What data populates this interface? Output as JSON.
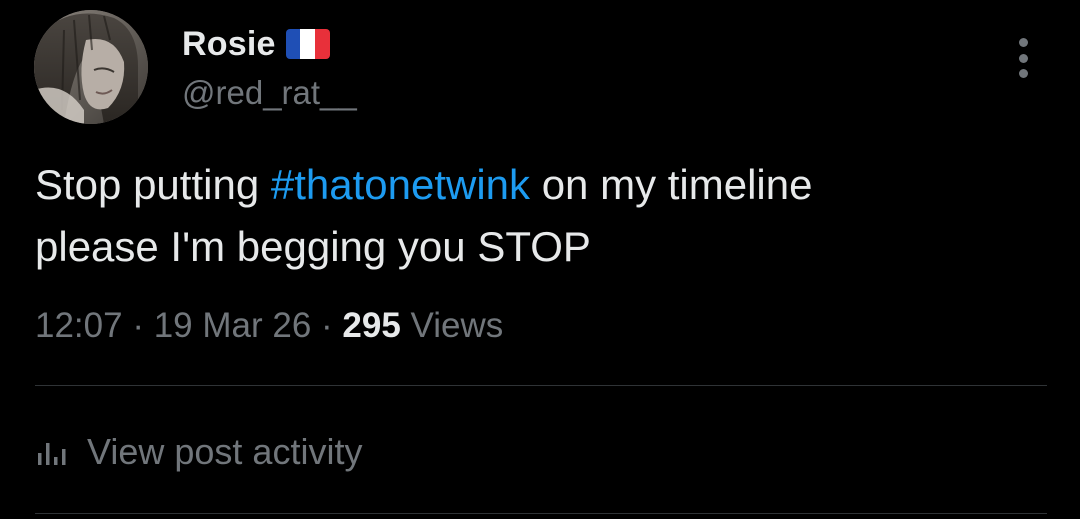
{
  "author": {
    "display_name": "Rosie",
    "handle": "@red_rat__",
    "flag_icon": "france-flag-icon",
    "flag_colors": [
      "#1f4fb5",
      "#ffffff",
      "#e8303a"
    ]
  },
  "tweet": {
    "text_part1": "Stop putting ",
    "hashtag": "#thatonetwink",
    "text_part2": " on my timeline",
    "text_line2": "please I'm begging you STOP"
  },
  "meta": {
    "time": "12:07",
    "separator": " · ",
    "date": "19 Mar 26",
    "views_count": "295",
    "views_label": " Views"
  },
  "activity": {
    "label": "View post activity",
    "icon": "bar-chart-icon"
  },
  "menu": {
    "icon": "more-vertical-icon"
  },
  "colors": {
    "background": "#000000",
    "primary_text": "#e7e9ea",
    "secondary_text": "#71767b",
    "hashtag": "#1d9bf0",
    "divider": "#2f3336"
  }
}
